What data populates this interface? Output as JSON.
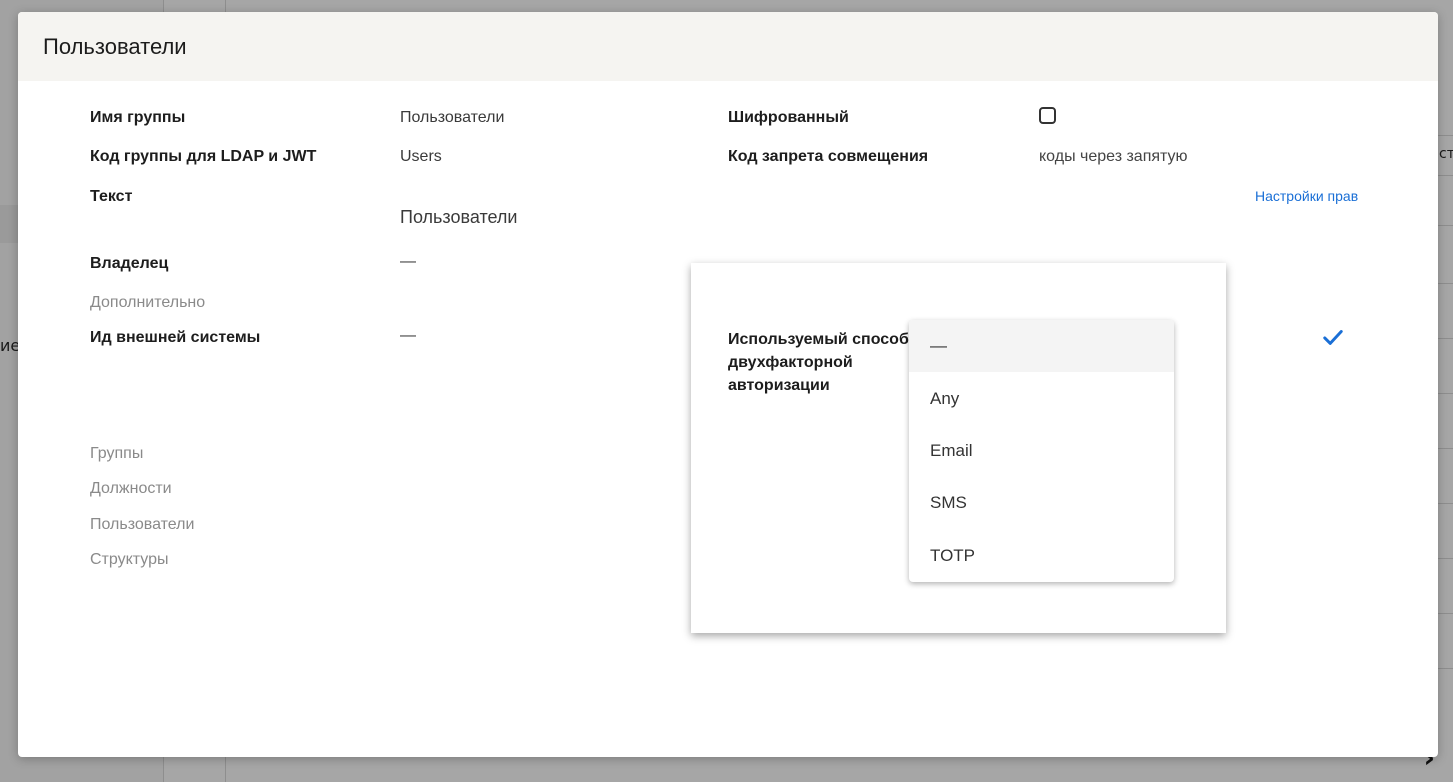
{
  "background": {
    "left_text_fragment": "ие",
    "right_text_fragment": "ст"
  },
  "modal": {
    "title": "Пользователи",
    "fields": {
      "group_name_label": "Имя группы",
      "group_name_value": "Пользователи",
      "ldap_code_label": "Код группы для LDAP и JWT",
      "ldap_code_value": "Users",
      "text_label": "Текст",
      "text_value": "Пользователи",
      "owner_label": "Владелец",
      "owner_value": "—",
      "additional_label": "Дополнительно",
      "external_id_label": "Ид внешней системы",
      "external_id_value": "—",
      "encrypted_label": "Шифрованный",
      "encrypted_checked": false,
      "conflict_code_label": "Код запрета совмещения",
      "conflict_code_placeholder": "коды через запятую",
      "permissions_link": "Настройки прав"
    },
    "sections": [
      "Группы",
      "Должности",
      "Пользователи",
      "Структуры"
    ]
  },
  "popup": {
    "label": "Используемый способ двухфакторной авторизации",
    "options": [
      "—",
      "Any",
      "Email",
      "SMS",
      "TOTP"
    ],
    "highlighted_index": 0
  },
  "colors": {
    "accent": "#1a6fd6",
    "header_bg": "#f5f4f1",
    "overlay": "#a6a6a6"
  }
}
